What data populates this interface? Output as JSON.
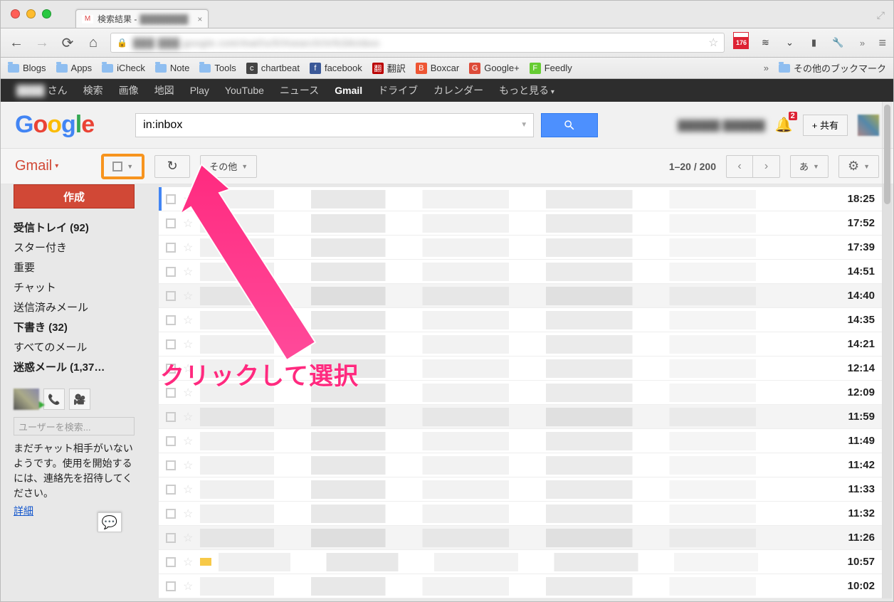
{
  "window": {
    "tab_title": "検索結果 - ",
    "tab_title_blur": "████████"
  },
  "nav": {
    "url_blur": "███ ███.google.com/mail/u/0/#search/in%3Ainbox",
    "gmail_badge": "176"
  },
  "bookmarks": [
    {
      "label": "Blogs",
      "type": "folder"
    },
    {
      "label": "Apps",
      "type": "folder"
    },
    {
      "label": "iCheck",
      "type": "folder"
    },
    {
      "label": "Note",
      "type": "folder"
    },
    {
      "label": "Tools",
      "type": "folder"
    },
    {
      "label": "chartbeat",
      "type": "icon",
      "color": "#444"
    },
    {
      "label": "facebook",
      "type": "icon",
      "color": "#3b5998"
    },
    {
      "label": "翻訳",
      "type": "icon",
      "color": "#b00"
    },
    {
      "label": "Boxcar",
      "type": "icon",
      "color": "#e53"
    },
    {
      "label": "Google+",
      "type": "icon",
      "color": "#dd4b39"
    },
    {
      "label": "Feedly",
      "type": "icon",
      "color": "#6c3"
    }
  ],
  "bookmarks_other": "その他のブックマーク",
  "gbar": {
    "blur_name": "████",
    "san": "さん",
    "items": [
      "検索",
      "画像",
      "地図",
      "Play",
      "YouTube",
      "ニュース",
      "Gmail",
      "ドライブ",
      "カレンダー",
      "もっと見る"
    ],
    "active": "Gmail"
  },
  "header": {
    "logo": "Google",
    "search_value": "in:inbox",
    "user_blur": "██████ ██████",
    "notif_count": "2",
    "share_label": "+ 共有"
  },
  "actionbar": {
    "gmail_label": "Gmail",
    "more_label": "その他",
    "page_info": "1–20 / 200",
    "ime_label": "あ"
  },
  "sidebar": {
    "compose": "作成",
    "items": [
      {
        "label": "受信トレイ (92)",
        "bold": true
      },
      {
        "label": "スター付き",
        "bold": false
      },
      {
        "label": "重要",
        "bold": false
      },
      {
        "label": "チャット",
        "bold": false
      },
      {
        "label": "送信済みメール",
        "bold": false
      },
      {
        "label": "下書き (32)",
        "bold": true
      },
      {
        "label": "すべてのメール",
        "bold": false
      },
      {
        "label": "迷惑メール (1,37…",
        "bold": true
      }
    ],
    "chat_placeholder": "ユーザーを検索...",
    "chat_info": "まだチャット相手がいないようです。使用を開始するには、連絡先を招待してください。",
    "chat_detail": "詳細"
  },
  "messages": [
    {
      "time": "18:25"
    },
    {
      "time": "17:52"
    },
    {
      "time": "17:39"
    },
    {
      "time": "14:51"
    },
    {
      "time": "14:40"
    },
    {
      "time": "14:35"
    },
    {
      "time": "14:21"
    },
    {
      "time": "12:14"
    },
    {
      "time": "12:09"
    },
    {
      "time": "11:59"
    },
    {
      "time": "11:49"
    },
    {
      "time": "11:42"
    },
    {
      "time": "11:33"
    },
    {
      "time": "11:32"
    },
    {
      "time": "11:26"
    },
    {
      "time": "10:57"
    },
    {
      "time": "10:02"
    }
  ],
  "annotation": {
    "text": "クリックして選択"
  }
}
